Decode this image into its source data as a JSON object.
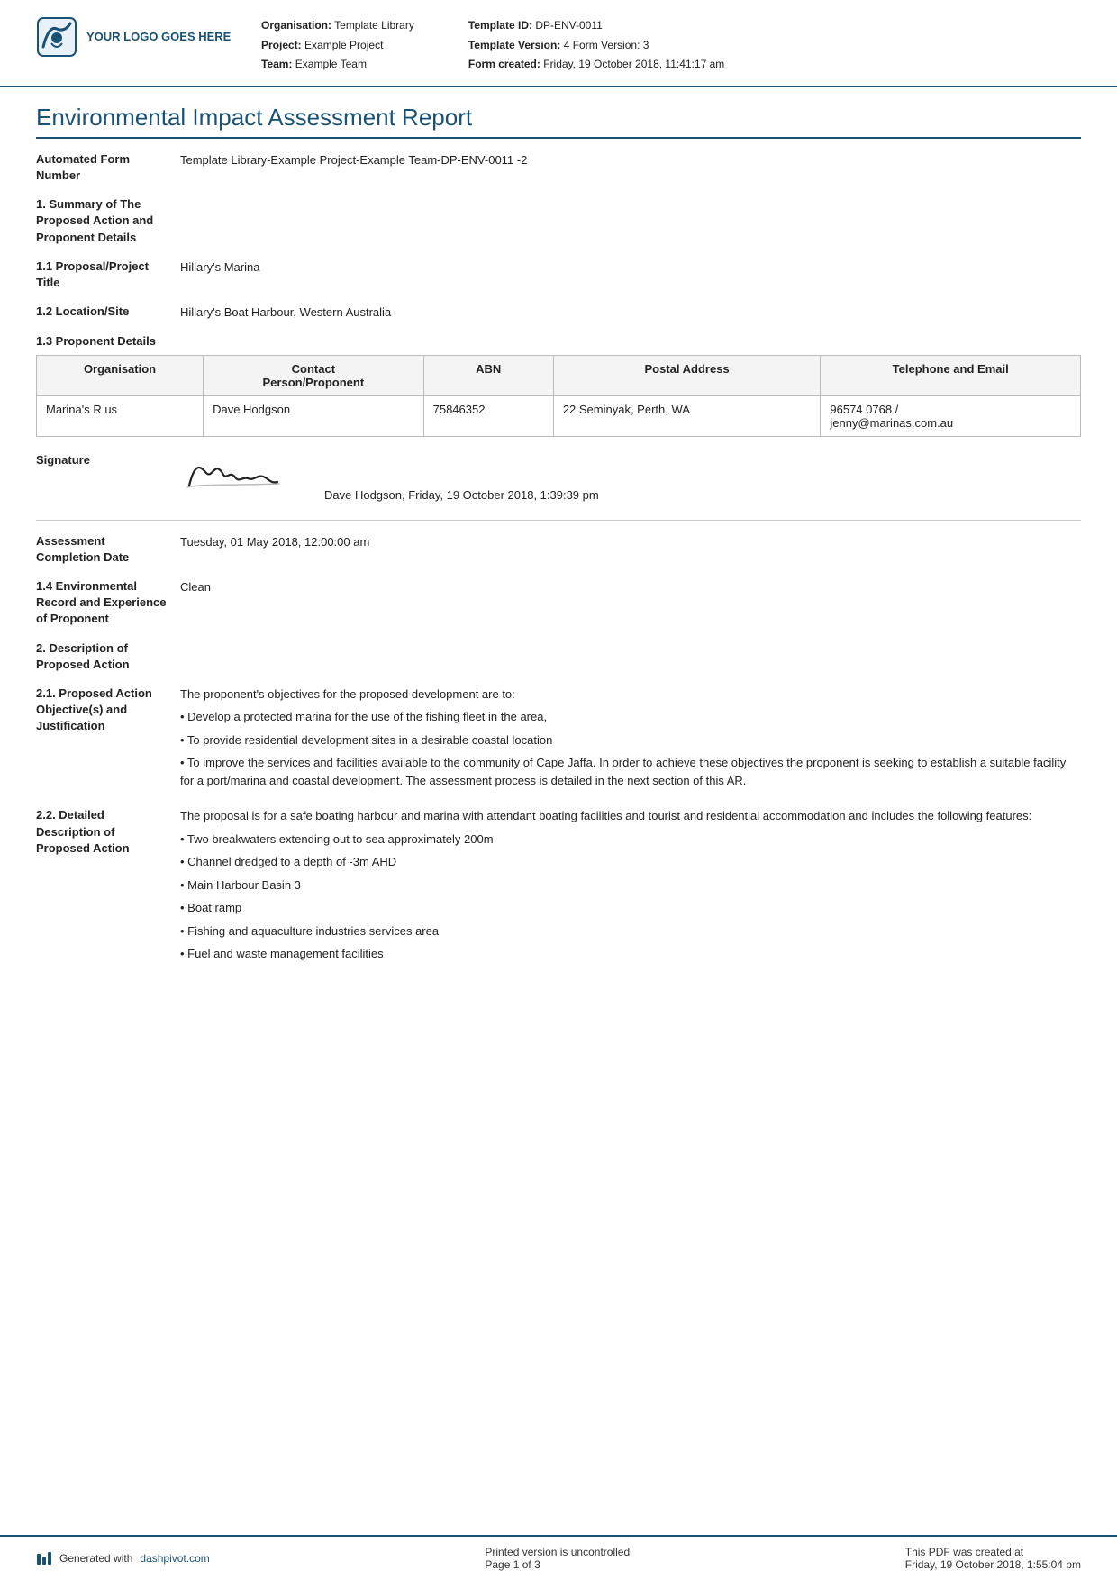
{
  "header": {
    "logo_text": "YOUR LOGO GOES HERE",
    "org_label": "Organisation:",
    "org_value": "Template Library",
    "project_label": "Project:",
    "project_value": "Example Project",
    "team_label": "Team:",
    "team_value": "Example Team",
    "template_id_label": "Template ID:",
    "template_id_value": "DP-ENV-0011",
    "template_version_label": "Template Version:",
    "template_version_value": "4",
    "form_version_label": "Form Version:",
    "form_version_value": "3",
    "form_created_label": "Form created:",
    "form_created_value": "Friday, 19 October 2018, 11:41:17 am"
  },
  "report": {
    "title": "Environmental Impact Assessment Report"
  },
  "automated_form": {
    "label": "Automated Form Number",
    "value": "Template Library-Example Project-Example Team-DP-ENV-0011   -2"
  },
  "section1": {
    "label": "1. Summary of The Proposed Action and Proponent Details"
  },
  "section1_1": {
    "label": "1.1 Proposal/Project Title",
    "value": "Hillary's Marina"
  },
  "section1_2": {
    "label": "1.2 Location/Site",
    "value": "Hillary's Boat Harbour, Western Australia"
  },
  "section1_3": {
    "heading": "1.3 Proponent Details",
    "table": {
      "headers": [
        "Organisation",
        "Contact Person/Proponent",
        "ABN",
        "Postal Address",
        "Telephone and Email"
      ],
      "rows": [
        [
          "Marina's R us",
          "Dave Hodgson",
          "75846352",
          "22 Seminyak, Perth, WA",
          "96574 0768 /\njenny@marinas.com.au"
        ]
      ]
    }
  },
  "signature": {
    "label": "Signature",
    "image_text": "Cavid",
    "info": "Dave Hodgson, Friday, 19 October 2018, 1:39:39 pm"
  },
  "assessment_completion": {
    "label": "Assessment Completion Date",
    "value": "Tuesday, 01 May 2018, 12:00:00 am"
  },
  "section1_4": {
    "label": "1.4 Environmental Record and Experience of Proponent",
    "value": "Clean"
  },
  "section2": {
    "label": "2. Description of Proposed Action"
  },
  "section2_1": {
    "label": "2.1. Proposed Action Objective(s) and Justification",
    "intro": "The proponent's objectives for the proposed development are to:",
    "bullets": [
      "• Develop a protected marina for the use of the fishing fleet in the area,",
      "• To provide residential development sites in a desirable coastal location",
      "• To improve the services and facilities available to the community of Cape Jaffa. In order to achieve these objectives the proponent is seeking to establish a suitable facility for a port/marina and coastal development. The assessment process is detailed in the next section of this AR."
    ]
  },
  "section2_2": {
    "label": "2.2. Detailed Description of Proposed Action",
    "intro": "The proposal is for a safe boating harbour and marina with attendant boating facilities and tourist and residential accommodation and includes the following features:",
    "bullets": [
      "• Two breakwaters extending out to sea approximately 200m",
      "• Channel dredged to a depth of -3m AHD",
      "• Main Harbour Basin 3",
      "• Boat ramp",
      "• Fishing and aquaculture industries services area",
      "• Fuel and waste management facilities"
    ]
  },
  "footer": {
    "generated_with": "Generated with",
    "dashpivot_url": "dashpivot.com",
    "uncontrolled": "Printed version is uncontrolled",
    "page": "Page 1 of 3",
    "pdf_created": "This PDF was created at",
    "pdf_created_date": "Friday, 19 October 2018, 1:55:04 pm"
  }
}
